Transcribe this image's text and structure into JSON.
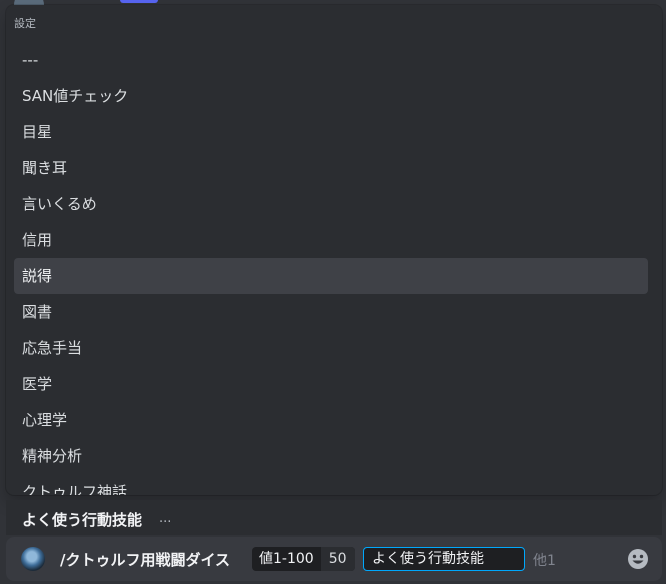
{
  "popup": {
    "header": "設定",
    "options": [
      {
        "label": "---",
        "selected": false
      },
      {
        "label": "SAN値チェック",
        "selected": false
      },
      {
        "label": "目星",
        "selected": false
      },
      {
        "label": "聞き耳",
        "selected": false
      },
      {
        "label": "言いくるめ",
        "selected": false
      },
      {
        "label": "信用",
        "selected": false
      },
      {
        "label": "説得",
        "selected": true
      },
      {
        "label": "図書",
        "selected": false
      },
      {
        "label": "応急手当",
        "selected": false
      },
      {
        "label": "医学",
        "selected": false
      },
      {
        "label": "心理学",
        "selected": false
      },
      {
        "label": "精神分析",
        "selected": false
      },
      {
        "label": "クトゥルフ神話",
        "selected": false
      }
    ]
  },
  "selected_option_bar": {
    "name": "よく使う行動技能",
    "more": "..."
  },
  "command_bar": {
    "bot_avatar_icon": "globe-avatar-icon",
    "command": "/クトゥルフ用戦闘ダイス",
    "params": {
      "dice_name": "値1-100",
      "dice_value": "50",
      "skill_name": "よく使う行動技能"
    },
    "more_params": "他1",
    "emoji_icon": "smiley-face-icon"
  },
  "colors": {
    "background": "#313338",
    "popup": "#2b2d31",
    "selected_option": "#3f4147",
    "focus_border": "#00a8fc",
    "accent": "#5865f2"
  }
}
